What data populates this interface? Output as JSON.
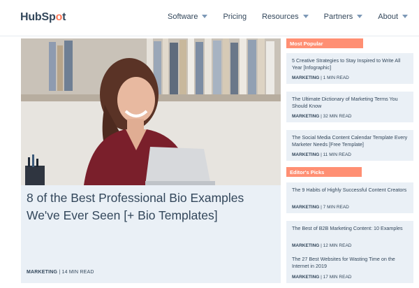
{
  "brand": {
    "logo_prefix": "HubSp",
    "logo_o": "o",
    "logo_suffix": "t",
    "accent": "#ff7a59"
  },
  "nav": {
    "items": [
      {
        "label": "Software",
        "dropdown": true
      },
      {
        "label": "Pricing",
        "dropdown": false
      },
      {
        "label": "Resources",
        "dropdown": true
      },
      {
        "label": "Partners",
        "dropdown": true
      },
      {
        "label": "About",
        "dropdown": true
      }
    ]
  },
  "hero": {
    "title": "8 of the Best Professional Bio Examples We've Ever Seen [+ Bio Templates]",
    "category": "MARKETING",
    "read_time": "14 MIN READ"
  },
  "most_popular": {
    "label": "Most Popular",
    "items": [
      {
        "title": "5 Creative Strategies to Stay Inspired to Write All Year [Infographic]",
        "category": "MARKETING",
        "read_time": "1 MIN READ"
      },
      {
        "title": "The Ultimate Dictionary of Marketing Terms You Should Know",
        "category": "MARKETING",
        "read_time": "32 MIN READ"
      },
      {
        "title": "The Social Media Content Calendar Template Every Marketer Needs [Free Template]",
        "category": "MARKETING",
        "read_time": "11 MIN READ"
      }
    ]
  },
  "editors_picks": {
    "label": "Editor's Picks",
    "items": [
      {
        "title": "The 9 Habits of Highly Successful Content Creators",
        "category": "MARKETING",
        "read_time": "7 MIN READ"
      },
      {
        "title": "The Best of B2B Marketing Content: 10 Examples",
        "category": "MARKETING",
        "read_time": "12 MIN READ"
      },
      {
        "title": "The 27 Best Websites for Wasting Time on the Internet in 2019",
        "category": "MARKETING",
        "read_time": "17 MIN READ"
      }
    ]
  },
  "colors": {
    "text": "#33475b",
    "card_bg": "#eaf0f6",
    "label_bg": "#ff8f73"
  }
}
